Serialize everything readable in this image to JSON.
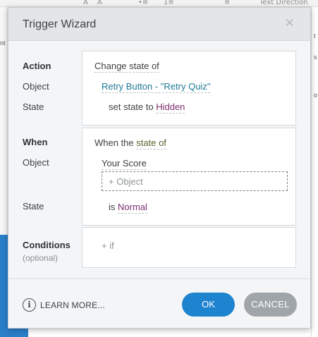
{
  "background": {
    "ribbon_glyphs": [
      "A",
      "A",
      "•≡",
      "1≡",
      "≡",
      "Text Direction"
    ],
    "left_cut_text": "nt",
    "right_cut_texts": [
      "t",
      "s",
      "o"
    ]
  },
  "dialog": {
    "title": "Trigger Wizard",
    "close_glyph": "✕",
    "action": {
      "section_label": "Action",
      "object_label": "Object",
      "state_label": "State",
      "action_value": "Change state of",
      "object_value": "Retry Button - \"Retry Quiz\"",
      "state_prefix": "set state to",
      "state_value": "Hidden"
    },
    "when": {
      "section_label": "When",
      "object_label": "Object",
      "state_label": "State",
      "when_prefix": "When the",
      "when_value": "state of",
      "object_value": "Your Score",
      "add_object_label": "+ Object",
      "state_prefix": "is",
      "state_value": "Normal"
    },
    "conditions": {
      "section_label": "Conditions",
      "optional_label": "(optional)",
      "add_if_label": "+ if"
    },
    "footer": {
      "info_glyph": "i",
      "learn_more_label": "LEARN MORE...",
      "ok_label": "OK",
      "cancel_label": "CANCEL"
    }
  },
  "colors": {
    "ok_button": "#1f84cf",
    "cancel_button": "#a0a5a9",
    "object_link": "#1f7a98",
    "state_value": "#7b2e6e",
    "when_value": "#55622b"
  }
}
